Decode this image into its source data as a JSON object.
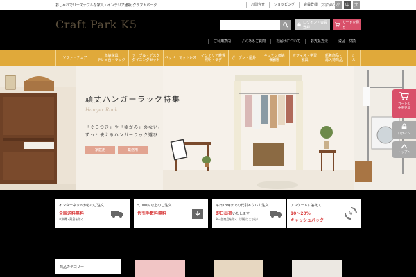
{
  "topbar": {
    "tagline": "おしゃれでリーズナブルな家具・インテリア通販 クラフトパーク",
    "links": [
      "お問合せ",
      "ショッピング",
      "会員登録",
      "ヘルプ"
    ],
    "font_size_label": "文字サイズ",
    "font_sizes": [
      "小",
      "中",
      "大"
    ]
  },
  "header": {
    "logo": "Craft Park K5",
    "search_placeholder": "",
    "login_label": "ログイン・会員登録",
    "cart_label": "カートを見る",
    "sublinks": [
      "ご利用案内",
      "よくあるご質問",
      "お届けについて",
      "お支払方法",
      "返品・交換"
    ]
  },
  "nav": {
    "items": [
      "ソファ・チェア",
      "収納家具\nテレビ台・ラック",
      "テーブル・デスク\nダイニングセット",
      "ベッド・マットレス",
      "インテリア雑貨\n照明・ラグ",
      "ガーデン・屋外",
      "キッチン収納\n食器棚",
      "オフィス・学習\n家具",
      "新着商品・\n再入荷商品",
      "セール"
    ]
  },
  "hero": {
    "title": "頑丈ハンガーラック特集",
    "subtitle": "Hanger Rack",
    "line1": "「ぐらつき」や「ゆがみ」のない、",
    "line2": "ずっと使えるハンガーラック選び",
    "tags": [
      "家庭用",
      "業務用"
    ]
  },
  "side": {
    "cart": "カートの\n中を見る",
    "login": "ログイン",
    "top": "トップへ"
  },
  "info_boxes": [
    {
      "line1": "インターネットからのご注文",
      "line2": "全国送料無料",
      "line3": "※沖縄・離島を除く",
      "icon": "truck-icon"
    },
    {
      "line1": "5,000円以上のご注文",
      "line2": "代引手数料無料",
      "line3": "",
      "icon": "box-icon"
    },
    {
      "line1": "平日13時までの代引＆クレカ注文",
      "line2": "即日出荷",
      "line3": "※一部商品を除く（詳細はこちら）",
      "line2b": "いたします",
      "icon": "truck-icon"
    },
    {
      "line1": "アンケートに答えて",
      "line2": "10～20%",
      "line3": "キャッシュバック",
      "icon": "cashback-icon"
    }
  ],
  "bottom": {
    "category_heading": "商品カテゴリー"
  }
}
